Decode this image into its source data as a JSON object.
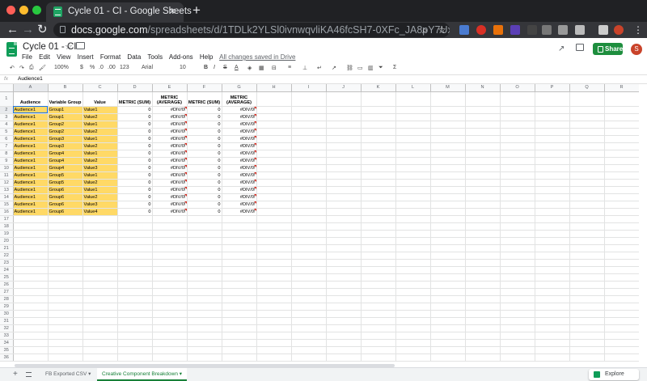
{
  "browser": {
    "tab_title": "Cycle 01 - CI - Google Sheets",
    "url_domain": "docs.google.com",
    "url_path": "/spreadsheets/d/1TDLk2YLSl0ivnwqvliKA46fcSH7-0XFc_JA8pY7UxnM/edit#gid=1..."
  },
  "sheets": {
    "doc_title": "Cycle 01 - CI",
    "menu": [
      "File",
      "Edit",
      "View",
      "Insert",
      "Format",
      "Data",
      "Tools",
      "Add-ons",
      "Help"
    ],
    "save_status": "All changes saved in Drive",
    "share_label": "Share",
    "avatar_letter": "S"
  },
  "toolbar": {
    "zoom": "100%",
    "currency": "$",
    "percent": "%",
    "dec_less": ".0",
    "dec_more": ".00",
    "format": "123",
    "font": "Arial",
    "size": "10",
    "bold": "B",
    "italic": "I",
    "strike": "S",
    "text_color": "A",
    "sum": "Σ"
  },
  "formula_bar": {
    "fx": "fx",
    "value": "Audience1"
  },
  "grid": {
    "columns": [
      "A",
      "B",
      "C",
      "D",
      "E",
      "F",
      "G",
      "H",
      "I",
      "J",
      "K",
      "L",
      "M",
      "N",
      "O",
      "P",
      "Q",
      "R"
    ],
    "row_count": 36,
    "headers": [
      "Audience",
      "Variable Group",
      "Value",
      "METRIC (SUM)",
      "METRIC (AVERAGE)",
      "METRIC (SUM)",
      "METRIC (AVERAGE)"
    ],
    "rows": [
      [
        "Audience1",
        "Group1",
        "Value1",
        "0",
        "#DIV/0!",
        "0",
        "#DIV/0!"
      ],
      [
        "Audience1",
        "Group1",
        "Value2",
        "0",
        "#DIV/0!",
        "0",
        "#DIV/0!"
      ],
      [
        "Audience1",
        "Group2",
        "Value1",
        "0",
        "#DIV/0!",
        "0",
        "#DIV/0!"
      ],
      [
        "Audience1",
        "Group2",
        "Value2",
        "0",
        "#DIV/0!",
        "0",
        "#DIV/0!"
      ],
      [
        "Audience1",
        "Group3",
        "Value1",
        "0",
        "#DIV/0!",
        "0",
        "#DIV/0!"
      ],
      [
        "Audience1",
        "Group3",
        "Value2",
        "0",
        "#DIV/0!",
        "0",
        "#DIV/0!"
      ],
      [
        "Audience1",
        "Group4",
        "Value1",
        "0",
        "#DIV/0!",
        "0",
        "#DIV/0!"
      ],
      [
        "Audience1",
        "Group4",
        "Value2",
        "0",
        "#DIV/0!",
        "0",
        "#DIV/0!"
      ],
      [
        "Audience1",
        "Group4",
        "Value3",
        "0",
        "#DIV/0!",
        "0",
        "#DIV/0!"
      ],
      [
        "Audience1",
        "Group5",
        "Value1",
        "0",
        "#DIV/0!",
        "0",
        "#DIV/0!"
      ],
      [
        "Audience1",
        "Group5",
        "Value2",
        "0",
        "#DIV/0!",
        "0",
        "#DIV/0!"
      ],
      [
        "Audience1",
        "Group6",
        "Value1",
        "0",
        "#DIV/0!",
        "0",
        "#DIV/0!"
      ],
      [
        "Audience1",
        "Group6",
        "Value2",
        "0",
        "#DIV/0!",
        "0",
        "#DIV/0!"
      ],
      [
        "Audience1",
        "Group6",
        "Value3",
        "0",
        "#DIV/0!",
        "0",
        "#DIV/0!"
      ],
      [
        "Audience1",
        "Group6",
        "Value4",
        "0",
        "#DIV/0!",
        "0",
        "#DIV/0!"
      ]
    ]
  },
  "sheet_tabs": [
    "FB Exported CSV",
    "Creative Component Breakdown"
  ],
  "active_tab": 1,
  "explore_label": "Explore",
  "colors": {
    "highlight": "#ffd966",
    "accent": "#1e8e3e",
    "selection": "#1a73e8"
  }
}
